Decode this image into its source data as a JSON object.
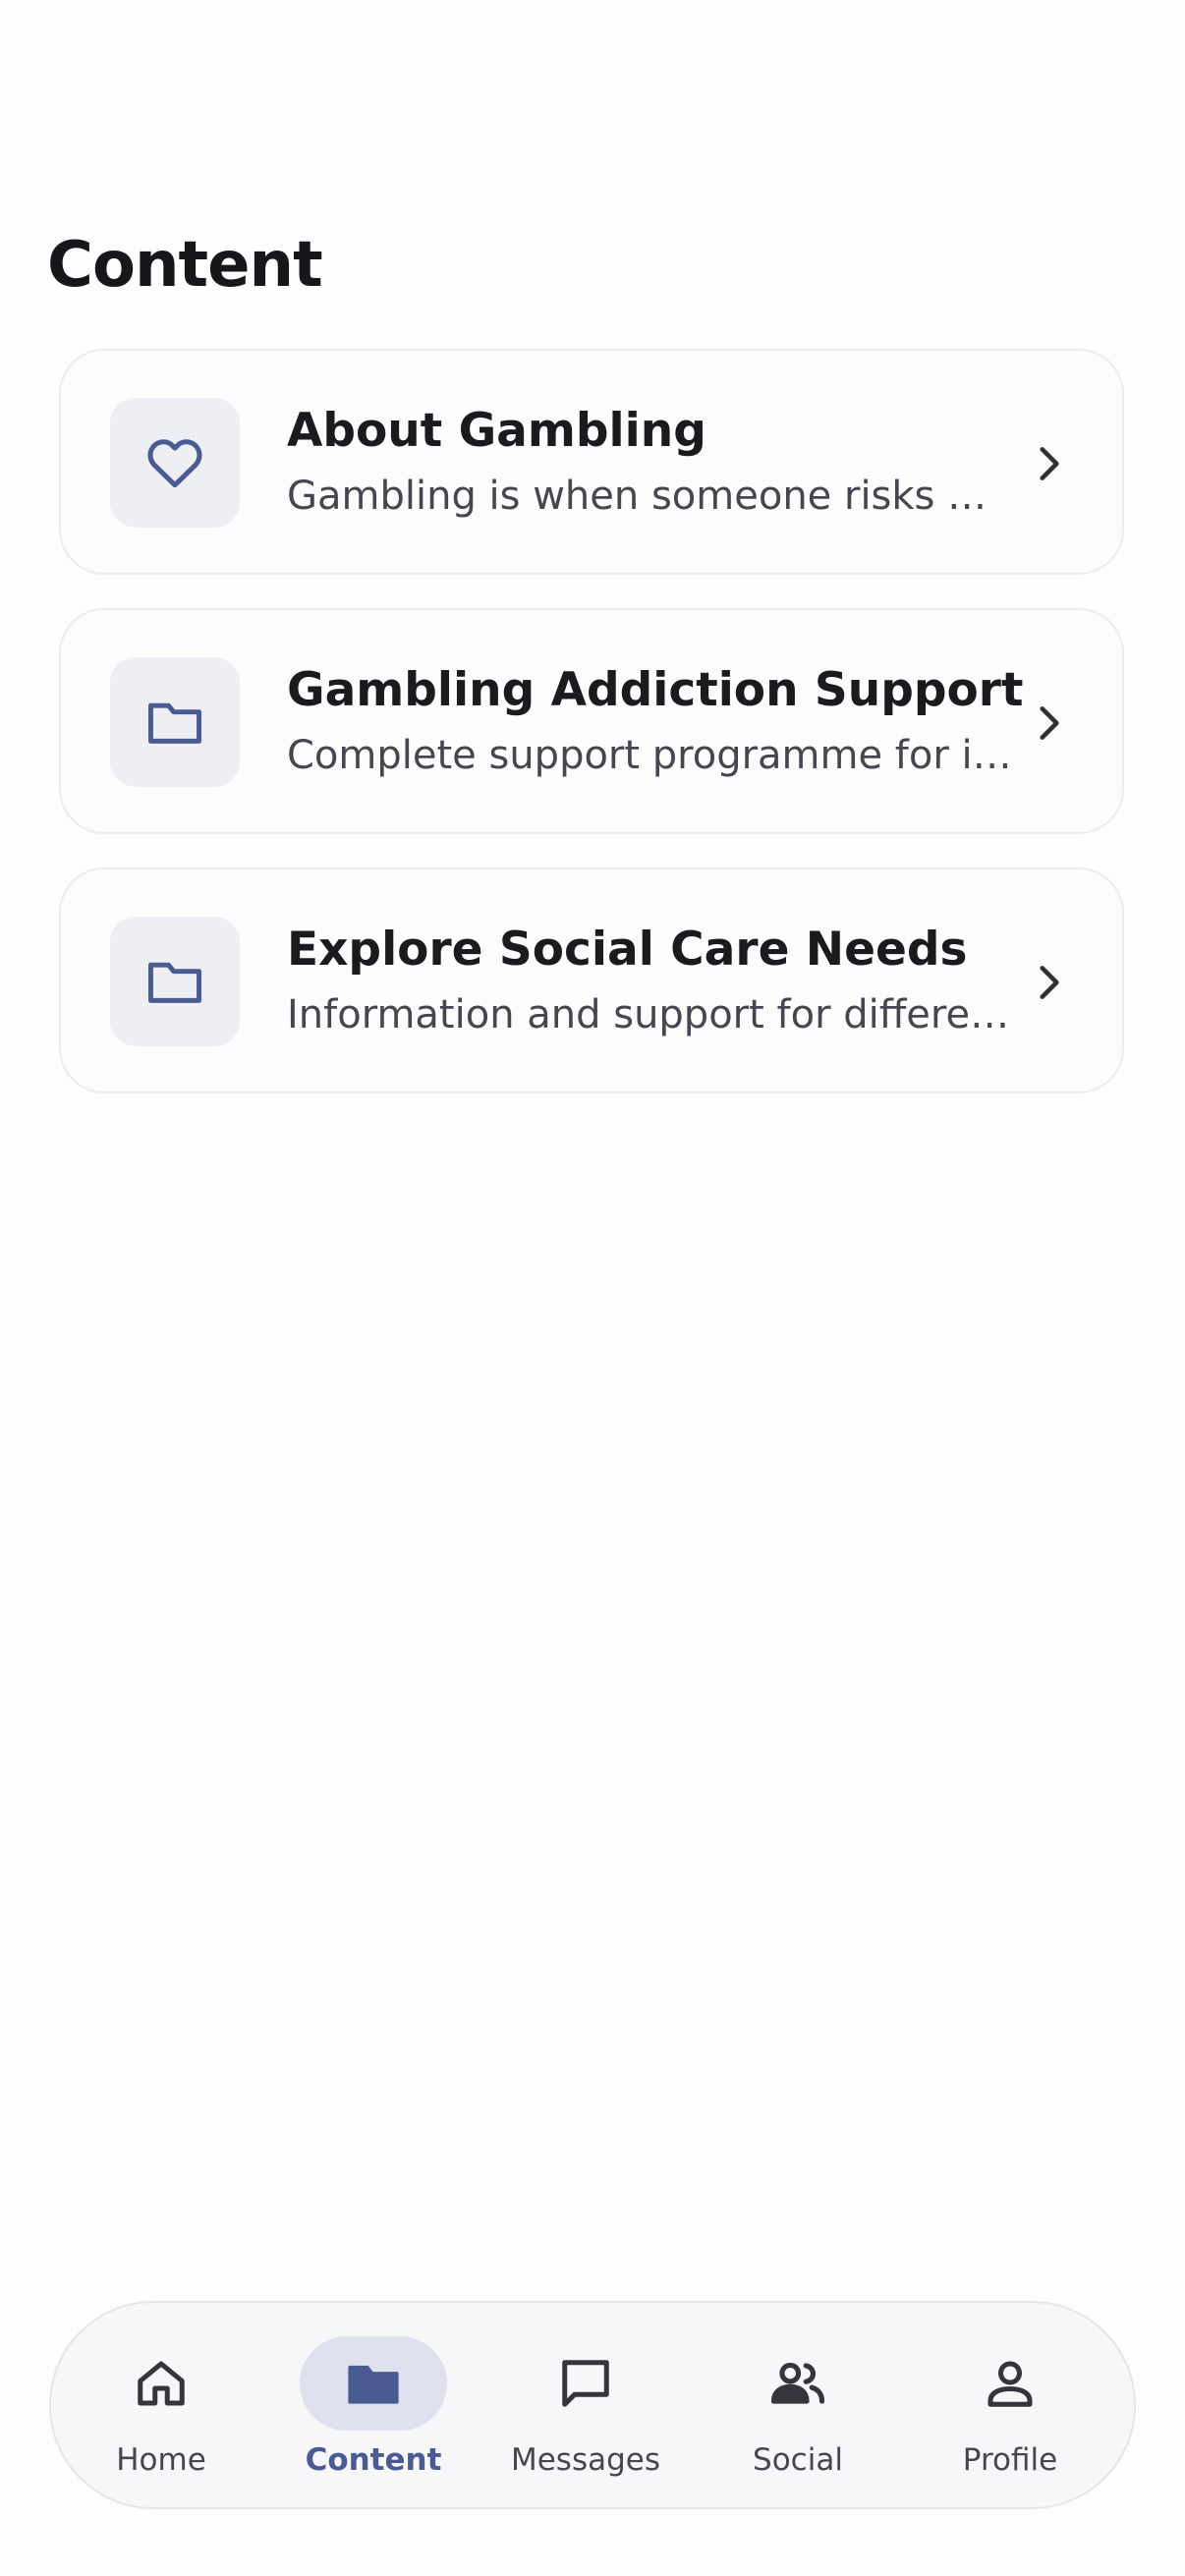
{
  "header": {
    "title": "Content"
  },
  "cards": [
    {
      "title": "About Gambling",
      "description": "Gambling is when someone risks money or something of value on an outcome",
      "icon": "heart-icon"
    },
    {
      "title": "Gambling Addiction Support",
      "description": "Complete support programme for individuals affected by gambling addiction",
      "icon": "folder-icon"
    },
    {
      "title": "Explore Social Care Needs",
      "description": "Information and support for different social care needs",
      "icon": "folder-icon"
    }
  ],
  "bottom_nav": {
    "items": [
      {
        "label": "Home",
        "icon": "home-icon",
        "active": false
      },
      {
        "label": "Content",
        "icon": "folder-icon",
        "active": true
      },
      {
        "label": "Messages",
        "icon": "message-icon",
        "active": false
      },
      {
        "label": "Social",
        "icon": "people-icon",
        "active": false
      },
      {
        "label": "Profile",
        "icon": "person-icon",
        "active": false
      }
    ]
  },
  "colors": {
    "accent": "#4a5a92",
    "icon_bg": "#eeeff4",
    "active_pill": "#dfe1ef",
    "text_primary": "#1b1b1f",
    "text_secondary": "#45464f"
  }
}
